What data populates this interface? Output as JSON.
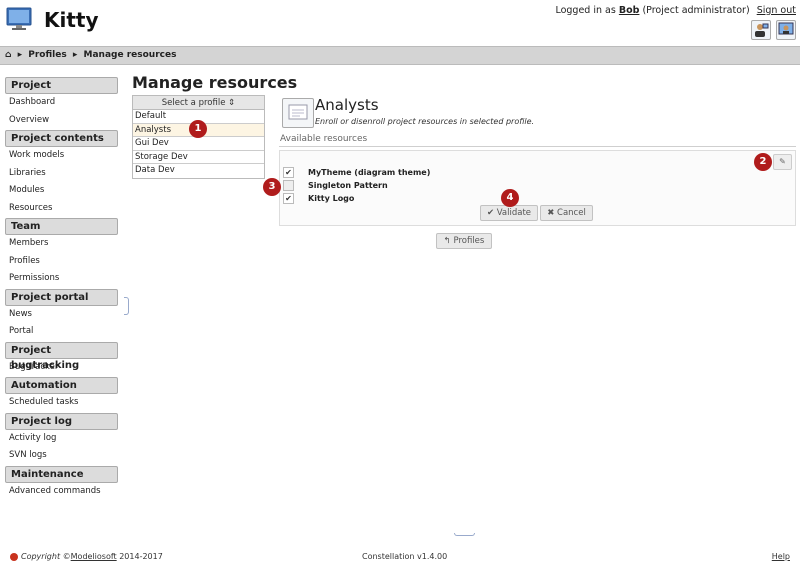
{
  "app": {
    "title": "Kitty"
  },
  "user": {
    "prefix": "Logged in as",
    "name": "Bob",
    "role": "(Project administrator)",
    "signout": "Sign out"
  },
  "breadcrumb": {
    "home_icon": "home-icon",
    "items": [
      "Profiles",
      "Manage resources"
    ]
  },
  "sidebar": {
    "sections": [
      {
        "title": "Project",
        "items": [
          "Dashboard",
          "Overview"
        ]
      },
      {
        "title": "Project contents",
        "items": [
          "Work models",
          "Libraries",
          "Modules",
          "Resources"
        ]
      },
      {
        "title": "Team",
        "items": [
          "Members",
          "Profiles",
          "Permissions"
        ]
      },
      {
        "title": "Project portal",
        "items": [
          "News",
          "Portal"
        ]
      },
      {
        "title": "Project bugtracking",
        "items": [
          "Bug tracker"
        ]
      },
      {
        "title": "Automation",
        "items": [
          "Scheduled tasks"
        ]
      },
      {
        "title": "Project log",
        "items": [
          "Activity log",
          "SVN logs"
        ]
      },
      {
        "title": "Maintenance",
        "items": [
          "Advanced commands"
        ]
      }
    ]
  },
  "main": {
    "title": "Manage resources",
    "profile_select": {
      "header": "Select a profile",
      "items": [
        "Default",
        "Analysts",
        "Gui Dev",
        "Storage Dev",
        "Data Dev"
      ],
      "selected": "Analysts"
    },
    "profile": {
      "name": "Analysts",
      "description": "Enroll or disenroll project resources in selected profile."
    },
    "available_label": "Available resources",
    "resources": [
      {
        "label": "MyTheme (diagram theme)",
        "checked": true
      },
      {
        "label": "Singleton Pattern",
        "checked": false
      },
      {
        "label": "Kitty Logo",
        "checked": true
      }
    ],
    "buttons": {
      "validate": "Validate",
      "cancel": "Cancel",
      "profiles": "Profiles"
    }
  },
  "markers": [
    "1",
    "2",
    "3",
    "4"
  ],
  "footer": {
    "copyright": "Copyright",
    "company": "Modeliosoft",
    "years": "2014-2017",
    "version": "Constellation v1.4.00",
    "help": "Help"
  },
  "colors": {
    "marker": "#b01c1c",
    "selected_row": "#fdf5e3",
    "section_bg": "#dcdcdc"
  }
}
